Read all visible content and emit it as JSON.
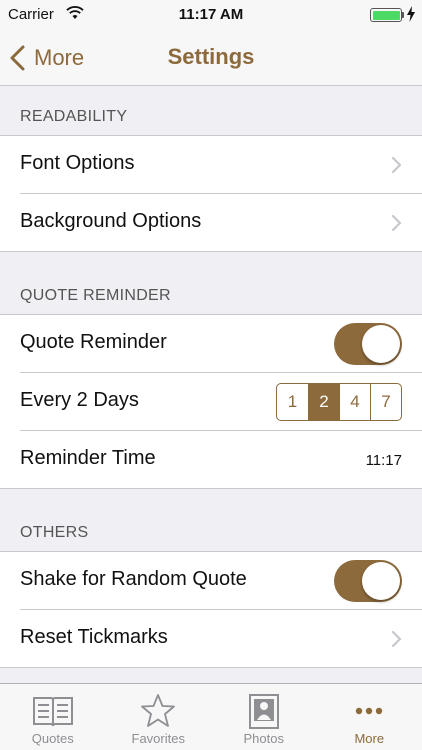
{
  "status_bar": {
    "carrier": "Carrier",
    "time": "11:17 AM",
    "battery_level": 1.0
  },
  "nav": {
    "back_label": "More",
    "title": "Settings"
  },
  "sections": {
    "readability": {
      "header": "READABILITY",
      "rows": [
        {
          "label": "Font Options"
        },
        {
          "label": "Background Options"
        }
      ]
    },
    "quote_reminder": {
      "header": "QUOTE REMINDER",
      "toggle_label": "Quote Reminder",
      "toggle_on": true,
      "frequency_label": "Every 2 Days",
      "frequency_options": [
        "1",
        "2",
        "4",
        "7"
      ],
      "frequency_selected": "2",
      "time_label": "Reminder Time",
      "time_value": "11:17"
    },
    "others": {
      "header": "OTHERS",
      "shake_label": "Shake for Random Quote",
      "shake_on": true,
      "reset_label": "Reset Tickmarks"
    }
  },
  "tab_bar": {
    "tabs": [
      {
        "label": "Quotes",
        "icon": "book-icon"
      },
      {
        "label": "Favorites",
        "icon": "star-icon"
      },
      {
        "label": "Photos",
        "icon": "photo-icon"
      },
      {
        "label": "More",
        "icon": "more-icon"
      }
    ],
    "selected": "More"
  },
  "colors": {
    "accent": "#8c6a3c",
    "background": "#efeff4",
    "separator": "#c8c7cc"
  }
}
